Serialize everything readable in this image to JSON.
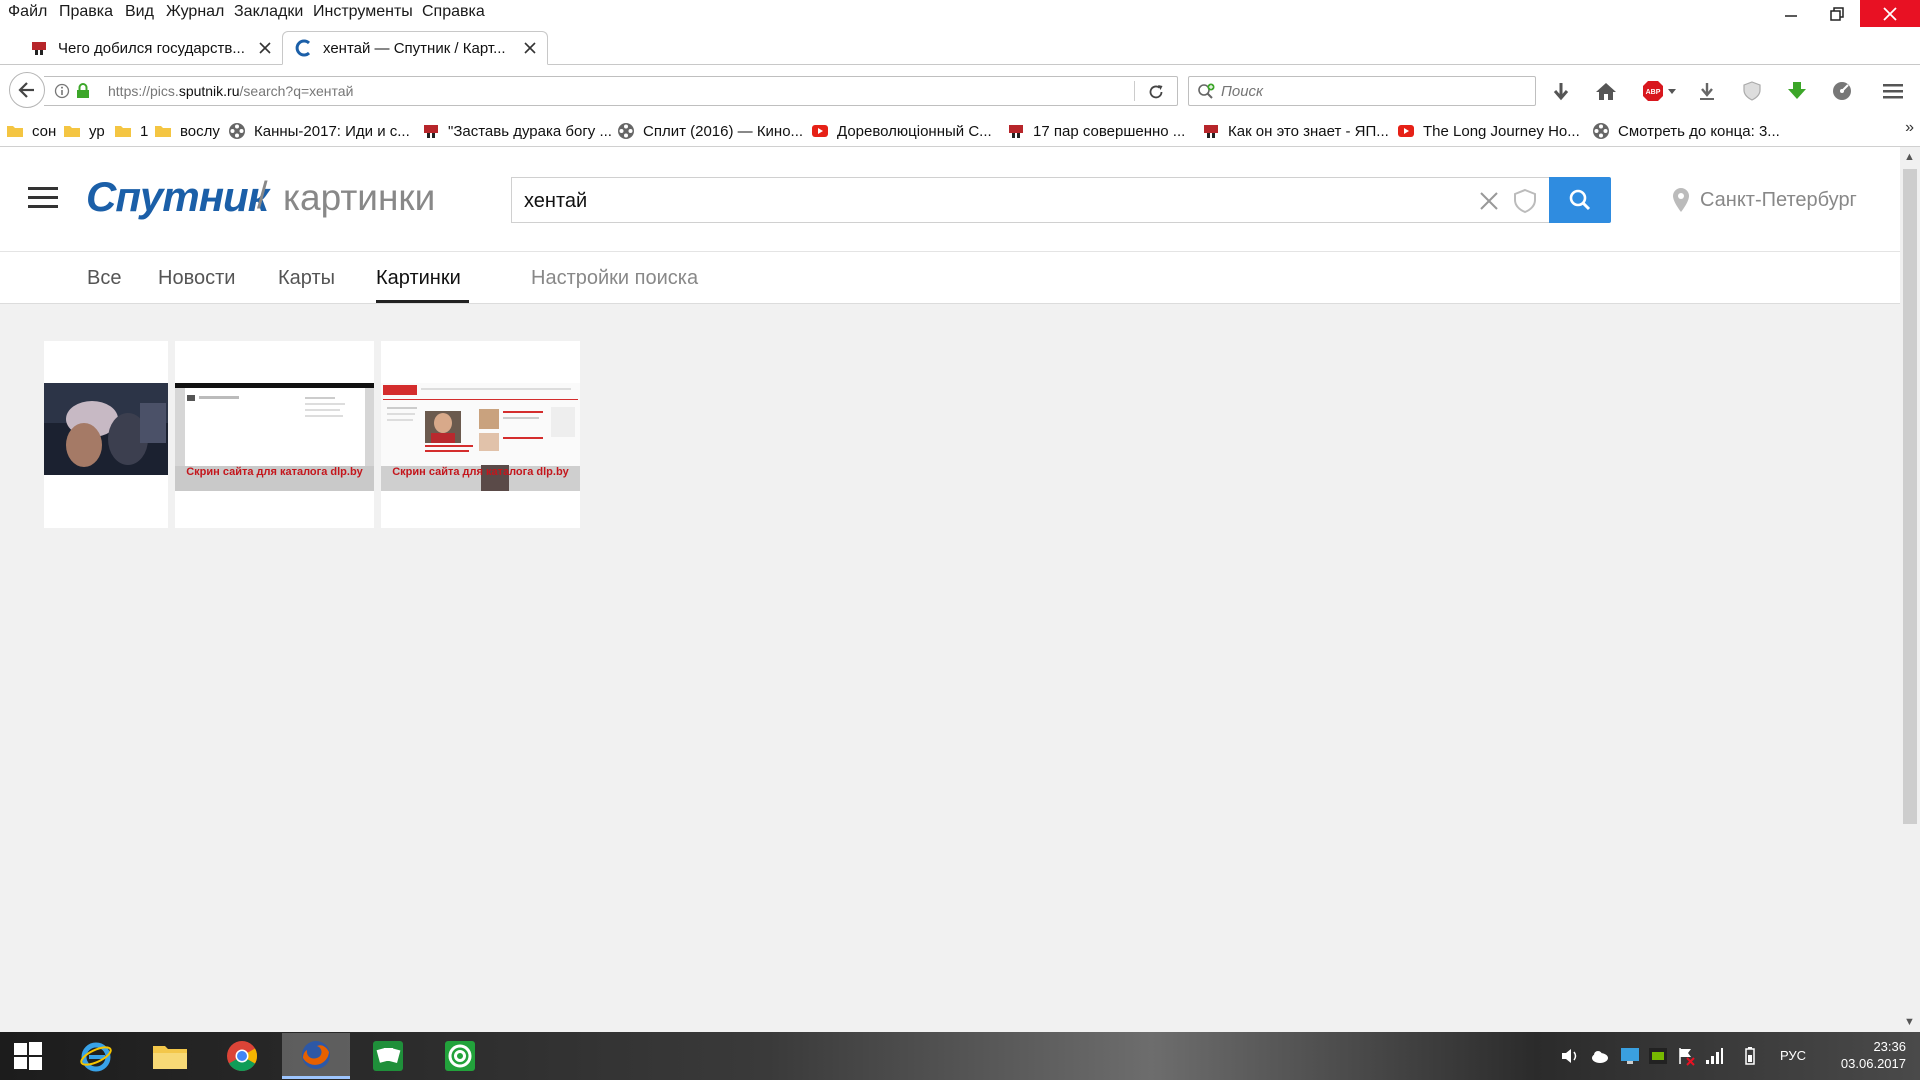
{
  "menubar": {
    "items": [
      "Файл",
      "Правка",
      "Вид",
      "Журнал",
      "Закладки",
      "Инструменты",
      "Справка"
    ]
  },
  "tabs": [
    {
      "label": "Чего добился государств...",
      "active": false
    },
    {
      "label": "хентай — Спутник / Карт...",
      "active": true
    }
  ],
  "navbar": {
    "url_prefix": "https://pics.",
    "url_domain": "sputnik.ru",
    "url_path": "/search?q=хентай",
    "search_placeholder": "Поиск"
  },
  "bookmarks": [
    "сон",
    "ур",
    "1",
    "вослу",
    "Канны-2017: Иди и с...",
    "\"Заставь дурака богу ...",
    "Сплит (2016) — Кино...",
    "Дореволюціонный С...",
    "17 пар совершенно ...",
    "Как он это знает - ЯП...",
    "The Long Journey Ho...",
    "Смотреть до конца: 3..."
  ],
  "bookmarks_more": "»",
  "site": {
    "logo": "Спутник",
    "slash": "/",
    "section": "картинки",
    "query": "хентай",
    "location": "Санкт-Петербург",
    "nav": [
      "Все",
      "Новости",
      "Карты",
      "Картинки"
    ],
    "settings": "Настройки поиска",
    "results": [
      {
        "caption": ""
      },
      {
        "caption": "Скрин сайта для каталога dlp.by"
      },
      {
        "caption": "Скрин сайта для каталога dlp.by"
      }
    ]
  },
  "taskbar": {
    "lang": "РУС",
    "time": "23:36",
    "date": "03.06.2017"
  },
  "colors": {
    "accent": "#2f8ce0",
    "logo": "#1b5fa8",
    "close": "#e81123"
  }
}
